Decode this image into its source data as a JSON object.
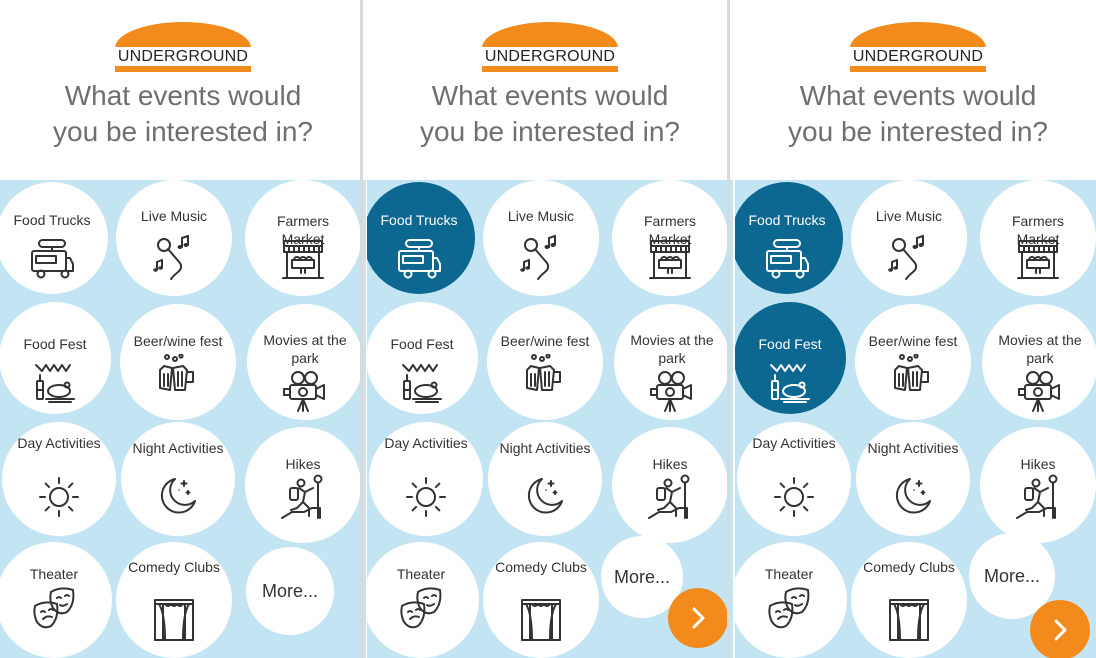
{
  "brand": {
    "name": "UNDERGROUND",
    "accent_color": "#f28b1c",
    "selected_color": "#0c6791",
    "grid_color": "#c3e4f3"
  },
  "question": {
    "line1": "What events would",
    "line2": "you be interested in?"
  },
  "events": [
    {
      "key": "food-trucks",
      "label": "Food Trucks",
      "icon": "food-truck-icon"
    },
    {
      "key": "live-music",
      "label": "Live Music",
      "icon": "microphone-icon"
    },
    {
      "key": "farmers-market",
      "label": "Farmers Market",
      "icon": "market-stall-icon"
    },
    {
      "key": "food-fest",
      "label": "Food Fest",
      "icon": "food-fest-icon"
    },
    {
      "key": "beer-wine-fest",
      "label": "Beer/wine fest",
      "icon": "beer-mugs-icon"
    },
    {
      "key": "movies-at-the-park",
      "label": "Movies at the park",
      "icon": "movie-camera-icon"
    },
    {
      "key": "day-activities",
      "label": "Day Activities",
      "icon": "sun-icon"
    },
    {
      "key": "night-activities",
      "label": "Night Activities",
      "icon": "moon-icon"
    },
    {
      "key": "hikes",
      "label": "Hikes",
      "icon": "hiker-icon"
    },
    {
      "key": "theater",
      "label": "Theater",
      "icon": "theater-masks-icon"
    },
    {
      "key": "comedy-clubs",
      "label": "Comedy Clubs",
      "icon": "curtain-stage-icon"
    }
  ],
  "more_label": "More...",
  "next_icon": "chevron-right-icon",
  "screens": [
    {
      "selected": [],
      "show_next": false
    },
    {
      "selected": [
        "food-trucks"
      ],
      "show_next": true
    },
    {
      "selected": [
        "food-trucks",
        "food-fest"
      ],
      "show_next": true
    }
  ]
}
